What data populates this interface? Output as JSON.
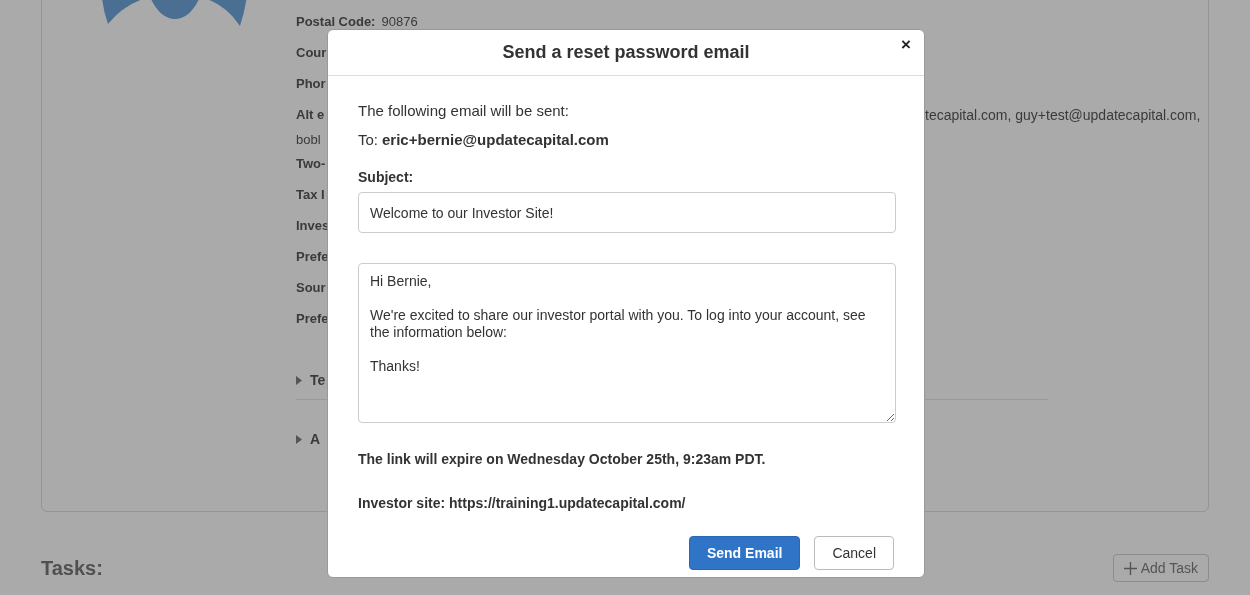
{
  "profile": {
    "fields": [
      {
        "label": "Postal Code:",
        "value": "90876"
      },
      {
        "label": "Cour"
      },
      {
        "label": "Phor"
      },
      {
        "label": "Alt e",
        "value_right": "tecapital.com, guy+test@updatecapital.com,",
        "value_line2": "bobl"
      },
      {
        "label": "Two-"
      },
      {
        "label": "Tax I"
      },
      {
        "label": "Inves"
      },
      {
        "label": "Prefe"
      },
      {
        "label": "Sour"
      },
      {
        "label": "Prefe"
      }
    ],
    "sections": [
      {
        "label": "Te",
        "expanded": false
      },
      {
        "label": "A",
        "expanded": false
      }
    ]
  },
  "tasks": {
    "title": "Tasks:",
    "add_button": "Add Task"
  },
  "modal": {
    "title": "Send a reset password email",
    "close": "×",
    "intro": "The following email will be sent:",
    "to_label": "To:",
    "to": "eric+bernie@updatecapital.com",
    "subject_label": "Subject:",
    "subject": "Welcome to our Investor Site!",
    "body": "Hi Bernie,\n\nWe're excited to share our investor portal with you. To log into your account, see the information below:\n\nThanks!",
    "expiry": "The link will expire on Wednesday October 25th, 9:23am PDT.",
    "site": "Investor site: https://training1.updatecapital.com/",
    "buttons": [
      {
        "label": "Send Email",
        "kind": "primary"
      },
      {
        "label": "Cancel",
        "kind": "secondary"
      }
    ]
  }
}
